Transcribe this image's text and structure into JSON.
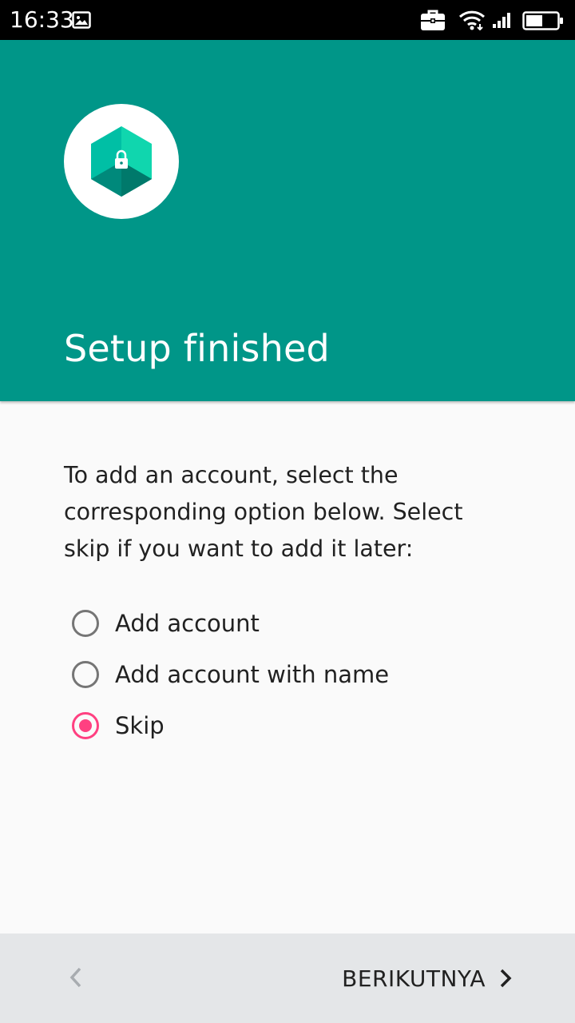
{
  "status_bar": {
    "time": "16:33",
    "icons": [
      "image-icon",
      "briefcase-icon",
      "wifi-icon",
      "signal-icon",
      "battery-icon"
    ]
  },
  "header": {
    "title": "Setup finished",
    "logo_icon": "lock-hexagon-icon",
    "background_color": "#009688"
  },
  "main": {
    "description": "To add an account, select the corresponding option below. Select skip if you want to add it later:",
    "options": [
      {
        "label": "Add account",
        "selected": false
      },
      {
        "label": "Add account with name",
        "selected": false
      },
      {
        "label": "Skip",
        "selected": true
      }
    ],
    "accent_color": "#ff4081"
  },
  "bottom_bar": {
    "back_icon": "chevron-left-icon",
    "next_label": "BERIKUTNYA",
    "next_icon": "chevron-right-icon"
  }
}
